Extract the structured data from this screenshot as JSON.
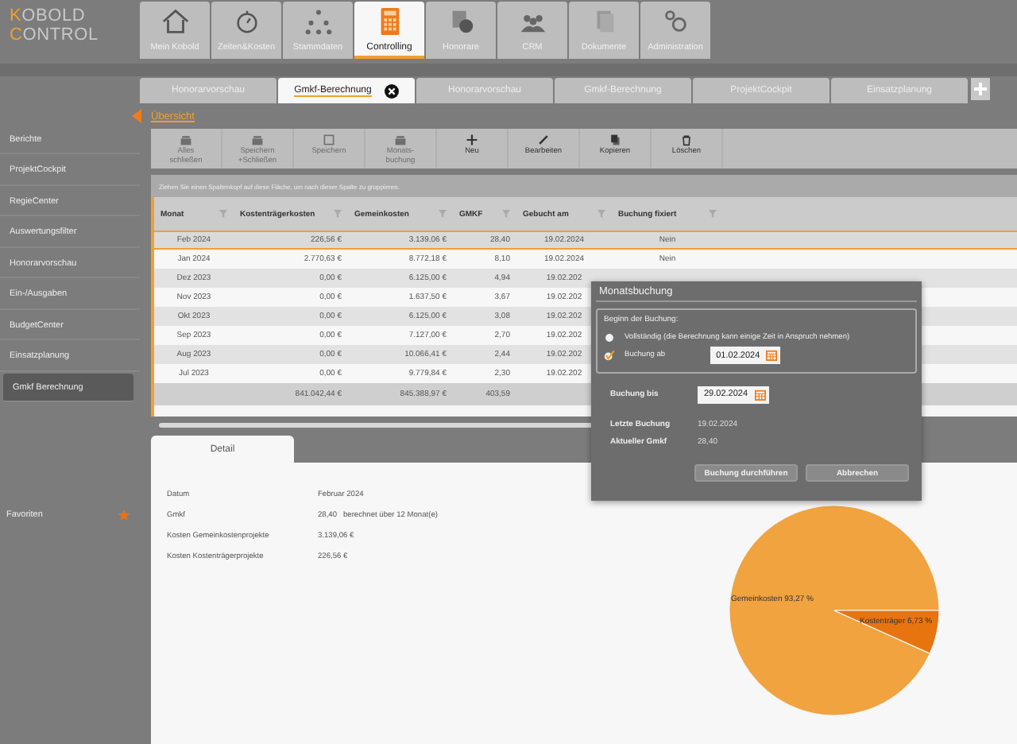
{
  "logo": [
    "KOBOLD",
    "CONTROL"
  ],
  "nav": [
    {
      "label": "Mein Kobold",
      "selected": false
    },
    {
      "label": "Zeiten&Kosten",
      "selected": false
    },
    {
      "label": "Stammdaten",
      "selected": false
    },
    {
      "label": "Controlling",
      "selected": true
    },
    {
      "label": "Honorare",
      "selected": false
    },
    {
      "label": "CRM",
      "selected": false
    },
    {
      "label": "Dokumente",
      "selected": false
    },
    {
      "label": "Administration",
      "selected": false
    }
  ],
  "doc_tabs": [
    {
      "label": "Honorarvorschau",
      "selected": false
    },
    {
      "label": "Gmkf-Berechnung",
      "selected": true
    },
    {
      "label": "Honorarvorschau",
      "selected": false
    },
    {
      "label": "Gmkf-Berechnung",
      "selected": false
    },
    {
      "label": "ProjektCockpit",
      "selected": false
    },
    {
      "label": "Einsatzplanung",
      "selected": false
    }
  ],
  "sidebar": {
    "items": [
      {
        "label": "Berichte",
        "selected": false
      },
      {
        "label": "ProjektCockpit",
        "selected": false
      },
      {
        "label": "RegieCenter",
        "selected": false
      },
      {
        "label": "Auswertungsfilter",
        "selected": false
      },
      {
        "label": "Honorarvorschau",
        "selected": false
      },
      {
        "label": "Ein-/Ausgaben",
        "selected": false
      },
      {
        "label": "BudgetCenter",
        "selected": false
      },
      {
        "label": "Einsatzplanung",
        "selected": false
      },
      {
        "label": "Gmkf Berechnung",
        "selected": true
      }
    ],
    "favorites": "Favoriten"
  },
  "breadcrumb": "Übersicht",
  "toolbar": [
    {
      "label": "Alles\nschließen",
      "disabled": true
    },
    {
      "label": "Speichern\n+Schließen",
      "disabled": true
    },
    {
      "label": "Speichern",
      "disabled": true
    },
    {
      "label": "Monats-\nbuchung",
      "disabled": true
    },
    {
      "label": "Neu",
      "disabled": false
    },
    {
      "label": "Bearbeiten",
      "disabled": false
    },
    {
      "label": "Kopieren",
      "disabled": false
    },
    {
      "label": "Löschen",
      "disabled": false
    }
  ],
  "table": {
    "group_hint": "Ziehen Sie einen Spaltenkopf auf diese Fläche, um nach dieser Spalte zu gruppieren.",
    "columns": [
      "Monat",
      "Kostenträgerkosten",
      "Gemeinkosten",
      "GMKF",
      "Gebucht am",
      "Buchung fixiert"
    ],
    "rows": [
      {
        "cells": [
          "Feb 2024",
          "226,56 €",
          "3.139,06 €",
          "28,40",
          "19.02.2024",
          "Nein"
        ],
        "selected": true
      },
      {
        "cells": [
          "Jan 2024",
          "2.770,63 €",
          "8.772,18 €",
          "8,10",
          "19.02.2024",
          "Nein"
        ],
        "selected": false
      },
      {
        "cells": [
          "Dez 2023",
          "0,00 €",
          "6.125,00 €",
          "4,94",
          "19.02.202"
        ],
        "selected": false
      },
      {
        "cells": [
          "Nov 2023",
          "0,00 €",
          "1.637,50 €",
          "3,67",
          "19.02.202"
        ],
        "selected": false
      },
      {
        "cells": [
          "Okt 2023",
          "0,00 €",
          "6.125,00 €",
          "3,08",
          "19.02.202"
        ],
        "selected": false
      },
      {
        "cells": [
          "Sep 2023",
          "0,00 €",
          "7.127,00 €",
          "2,70",
          "19.02.202"
        ],
        "selected": false
      },
      {
        "cells": [
          "Aug 2023",
          "0,00 €",
          "10.066,41 €",
          "2,44",
          "19.02.202"
        ],
        "selected": false
      },
      {
        "cells": [
          "Jul 2023",
          "0,00 €",
          "9.779,84 €",
          "2,30",
          "19.02.202"
        ],
        "selected": false
      }
    ],
    "totals": [
      "841.042,44 €",
      "845.388,97 €",
      "403,59"
    ]
  },
  "detail": {
    "tab": "Detail",
    "fields": [
      {
        "label": "Datum",
        "value": "Februar 2024"
      },
      {
        "label": "Gmkf",
        "value": "28,40   berechnet über 12 Monat(e)"
      },
      {
        "label": "Kosten Gemeinkostenprojekte",
        "value": "3.139,06 €"
      },
      {
        "label": "Kosten Kostenträgerprojekte",
        "value": "226,56 €"
      }
    ],
    "chart_data": {
      "type": "pie",
      "categories": [
        "Gemeinkosten",
        "Kostenträger"
      ],
      "values": [
        93.27,
        6.73
      ],
      "value_labels": [
        "93,27 %",
        "6,73 %"
      ]
    }
  },
  "dialog": {
    "title": "Monatsbuchung",
    "group_label": "Beginn der Buchung:",
    "options": [
      {
        "label": "Vollständig (die Berechnung kann einige Zeit in Anspruch nehmen)",
        "selected": false
      },
      {
        "label": "Buchung ab",
        "selected": true,
        "date": "01.02.2024"
      }
    ],
    "end_label": "Buchung bis",
    "end_date": "29.02.2024",
    "info": [
      {
        "label": "Letzte Buchung",
        "value": "19.02.2024"
      },
      {
        "label": "Aktueller Gmkf",
        "value": "28,40"
      }
    ],
    "buttons": [
      "Buchung durchführen",
      "Abbrechen"
    ]
  }
}
